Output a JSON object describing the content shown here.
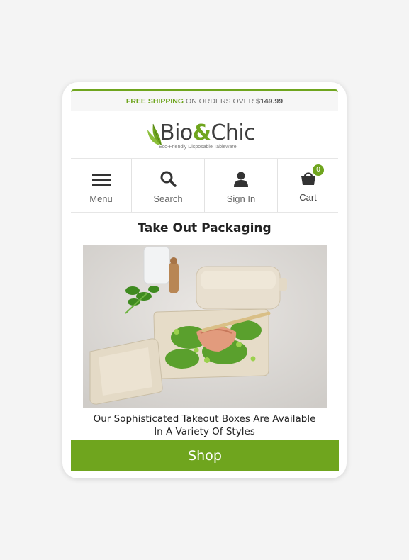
{
  "banner": {
    "prefix": "FREE SHIPPING",
    "middle": "ON ORDERS OVER",
    "amount": "$149.99"
  },
  "logo": {
    "name_part1": "Bio",
    "name_amp": "&",
    "name_part2": "Chic",
    "tagline": "Eco-Friendly Disposable Tableware"
  },
  "nav": {
    "items": [
      {
        "label": "Menu",
        "icon": "hamburger-icon"
      },
      {
        "label": "Search",
        "icon": "search-icon"
      },
      {
        "label": "Sign In",
        "icon": "user-icon"
      },
      {
        "label": "Cart",
        "icon": "cart-icon",
        "count": "0"
      }
    ]
  },
  "section": {
    "title": "Take Out Packaging",
    "caption_line1": "Our Sophisticated Takeout Boxes Are Available",
    "caption_line2": "In A Variety Of Styles",
    "button": "Shop"
  },
  "colors": {
    "accent": "#6fa51e",
    "text": "#222222",
    "muted": "#666666"
  }
}
